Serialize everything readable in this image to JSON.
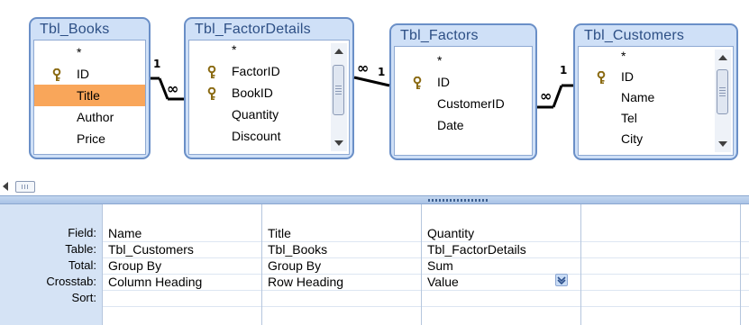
{
  "tables": [
    {
      "title": "Tbl_Books",
      "fields": [
        "*",
        "ID",
        "Title",
        "Author",
        "Price"
      ],
      "key_fields": [
        "ID"
      ],
      "selected_field": "Title"
    },
    {
      "title": "Tbl_FactorDetails",
      "fields": [
        "*",
        "FactorID",
        "BookID",
        "Quantity",
        "Discount"
      ],
      "key_fields": [
        "FactorID",
        "BookID"
      ]
    },
    {
      "title": "Tbl_Factors",
      "fields": [
        "*",
        "ID",
        "CustomerID",
        "Date"
      ],
      "key_fields": [
        "ID"
      ]
    },
    {
      "title": "Tbl_Customers",
      "fields": [
        "*",
        "ID",
        "Name",
        "Tel",
        "City"
      ],
      "key_fields": [
        "ID"
      ]
    }
  ],
  "relationships": [
    {
      "one_label": "1",
      "many_label": "∞"
    },
    {
      "one_label": "1",
      "many_label": "∞"
    },
    {
      "one_label": "1",
      "many_label": "∞"
    }
  ],
  "grid": {
    "row_labels": [
      "Field:",
      "Table:",
      "Total:",
      "Crosstab:",
      "Sort:"
    ],
    "columns": [
      {
        "field": "Name",
        "table": "Tbl_Customers",
        "total": "Group By",
        "crosstab": "Column Heading",
        "sort": ""
      },
      {
        "field": "Title",
        "table": "Tbl_Books",
        "total": "Group By",
        "crosstab": "Row Heading",
        "sort": ""
      },
      {
        "field": "Quantity",
        "table": "Tbl_FactorDetails",
        "total": "Sum",
        "crosstab": "Value",
        "sort": ""
      }
    ]
  },
  "colors": {
    "selection": "#f9a65a",
    "table_frame": "#6a8fc7",
    "title_text": "#2d4f85"
  },
  "icons": [
    "key-icon",
    "scroll-up-arrow-icon",
    "scroll-down-arrow-icon",
    "dropdown-arrow-icon"
  ]
}
